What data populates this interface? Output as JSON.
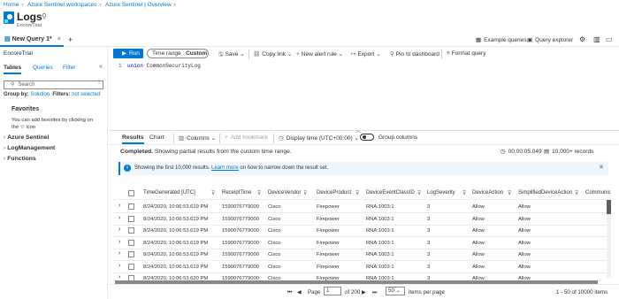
{
  "breadcrumb": [
    "Home",
    "Azure Sentinel workspaces",
    "Azure Sentinel | Overview"
  ],
  "header": {
    "title": "Logs",
    "subtitle": "EncoreTrial"
  },
  "tabs": {
    "active": "New Query 1*",
    "close": "×",
    "new": "+"
  },
  "topright": {
    "example_queries": "Example queries",
    "query_explorer": "Query explorer"
  },
  "scope": "EncoreTrial",
  "toolbar": {
    "run": "Run",
    "time_range_label": "Time range :",
    "time_range_value": "Custom",
    "save": "Save",
    "copy_link": "Copy link",
    "new_alert": "New alert rule",
    "export": "Export",
    "pin": "Pin to dashboard",
    "format": "Format query"
  },
  "left": {
    "tabs": [
      "Tables",
      "Queries",
      "Filter"
    ],
    "search_placeholder": "Search",
    "group_by_label": "Group by:",
    "group_by_value": "Solution",
    "filters_label": "Filters:",
    "filters_value": "not selected",
    "favorites_title": "Favorites",
    "favorites_hint_1": "You can add favorites by clicking on",
    "favorites_hint_2": "the ☆ icon",
    "tree": [
      "Azure Sentinel",
      "LogManagement",
      "Functions"
    ]
  },
  "editor": {
    "line": "1",
    "keyword": "union",
    "rest": " CommonSecurityLog"
  },
  "results": {
    "tabs": [
      "Results",
      "Chart"
    ],
    "columns_btn": "Columns",
    "add_bookmark": "Add bookmark",
    "display_time": "Display time (UTC+00:00)",
    "group_columns": "Group columns",
    "status_bold": "Completed.",
    "status_rest": " Showing partial results from the custom time range.",
    "exec_time": "00:00:05.049",
    "record_count": "10,000+ records",
    "info_pre": "Showing the first 10,000 results. ",
    "info_link": "Learn more",
    "info_post": " on how to narrow down the result set."
  },
  "grid": {
    "headers": [
      "TimeGenerated [UTC]",
      "ReceiptTime",
      "DeviceVendor",
      "DeviceProduct",
      "DeviceEventClassID",
      "LogSeverity",
      "DeviceAction",
      "SimplifiedDeviceAction",
      "Communic"
    ],
    "rows": [
      [
        "8/24/2020, 10:06:53.619 PM",
        "1590076779000",
        "Cisco",
        "Firepower",
        "RNA:1003:1",
        "3",
        "Allow",
        "Allow"
      ],
      [
        "8/24/2020, 10:06:53.619 PM",
        "1590076779000",
        "Cisco",
        "Firepower",
        "RNA:1003:1",
        "3",
        "Allow",
        "Allow"
      ],
      [
        "8/24/2020, 10:06:53.619 PM",
        "1590076779000",
        "Cisco",
        "Firepower",
        "RNA:1003:1",
        "3",
        "Allow",
        "Allow"
      ],
      [
        "8/24/2020, 10:06:53.619 PM",
        "1590076779000",
        "Cisco",
        "Firepower",
        "RNA:1003:1",
        "3",
        "Allow",
        "Allow"
      ],
      [
        "8/24/2020, 10:06:53.619 PM",
        "1590076779000",
        "Cisco",
        "Firepower",
        "RNA:1003:1",
        "3",
        "Allow",
        "Allow"
      ],
      [
        "8/24/2020, 10:06:53.619 PM",
        "1590076779000",
        "Cisco",
        "Firepower",
        "RNA:1003:1",
        "3",
        "Allow",
        "Allow"
      ],
      [
        "8/24/2020, 10:06:53.620 PM",
        "1590076779000",
        "Cisco",
        "Firepower",
        "RNA:1003:1",
        "3",
        "Allow",
        "Allow"
      ]
    ]
  },
  "pager": {
    "page_label": "Page",
    "page": "1",
    "of": "of 200",
    "page_size": "50",
    "per_page": "items per page",
    "range": "1 - 50 of 10000 items"
  }
}
